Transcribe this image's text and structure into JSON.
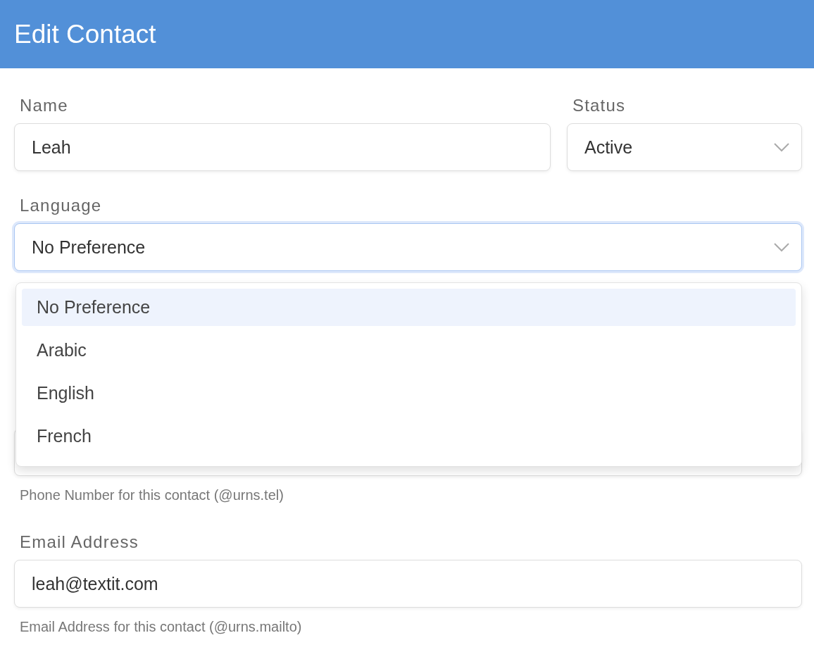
{
  "header": {
    "title": "Edit Contact"
  },
  "name_field": {
    "label": "Name",
    "value": "Leah"
  },
  "status_field": {
    "label": "Status",
    "value": "Active"
  },
  "language_field": {
    "label": "Language",
    "value": "No Preference",
    "expanded": true,
    "options": [
      {
        "label": "No Preference",
        "selected": true
      },
      {
        "label": "Arabic",
        "selected": false
      },
      {
        "label": "English",
        "selected": false
      },
      {
        "label": "French",
        "selected": false
      }
    ]
  },
  "phone_field": {
    "help": "Phone Number for this contact (@urns.tel)"
  },
  "email_field": {
    "label": "Email Address",
    "value": "leah@textit.com",
    "help": "Email Address for this contact (@urns.mailto)"
  }
}
